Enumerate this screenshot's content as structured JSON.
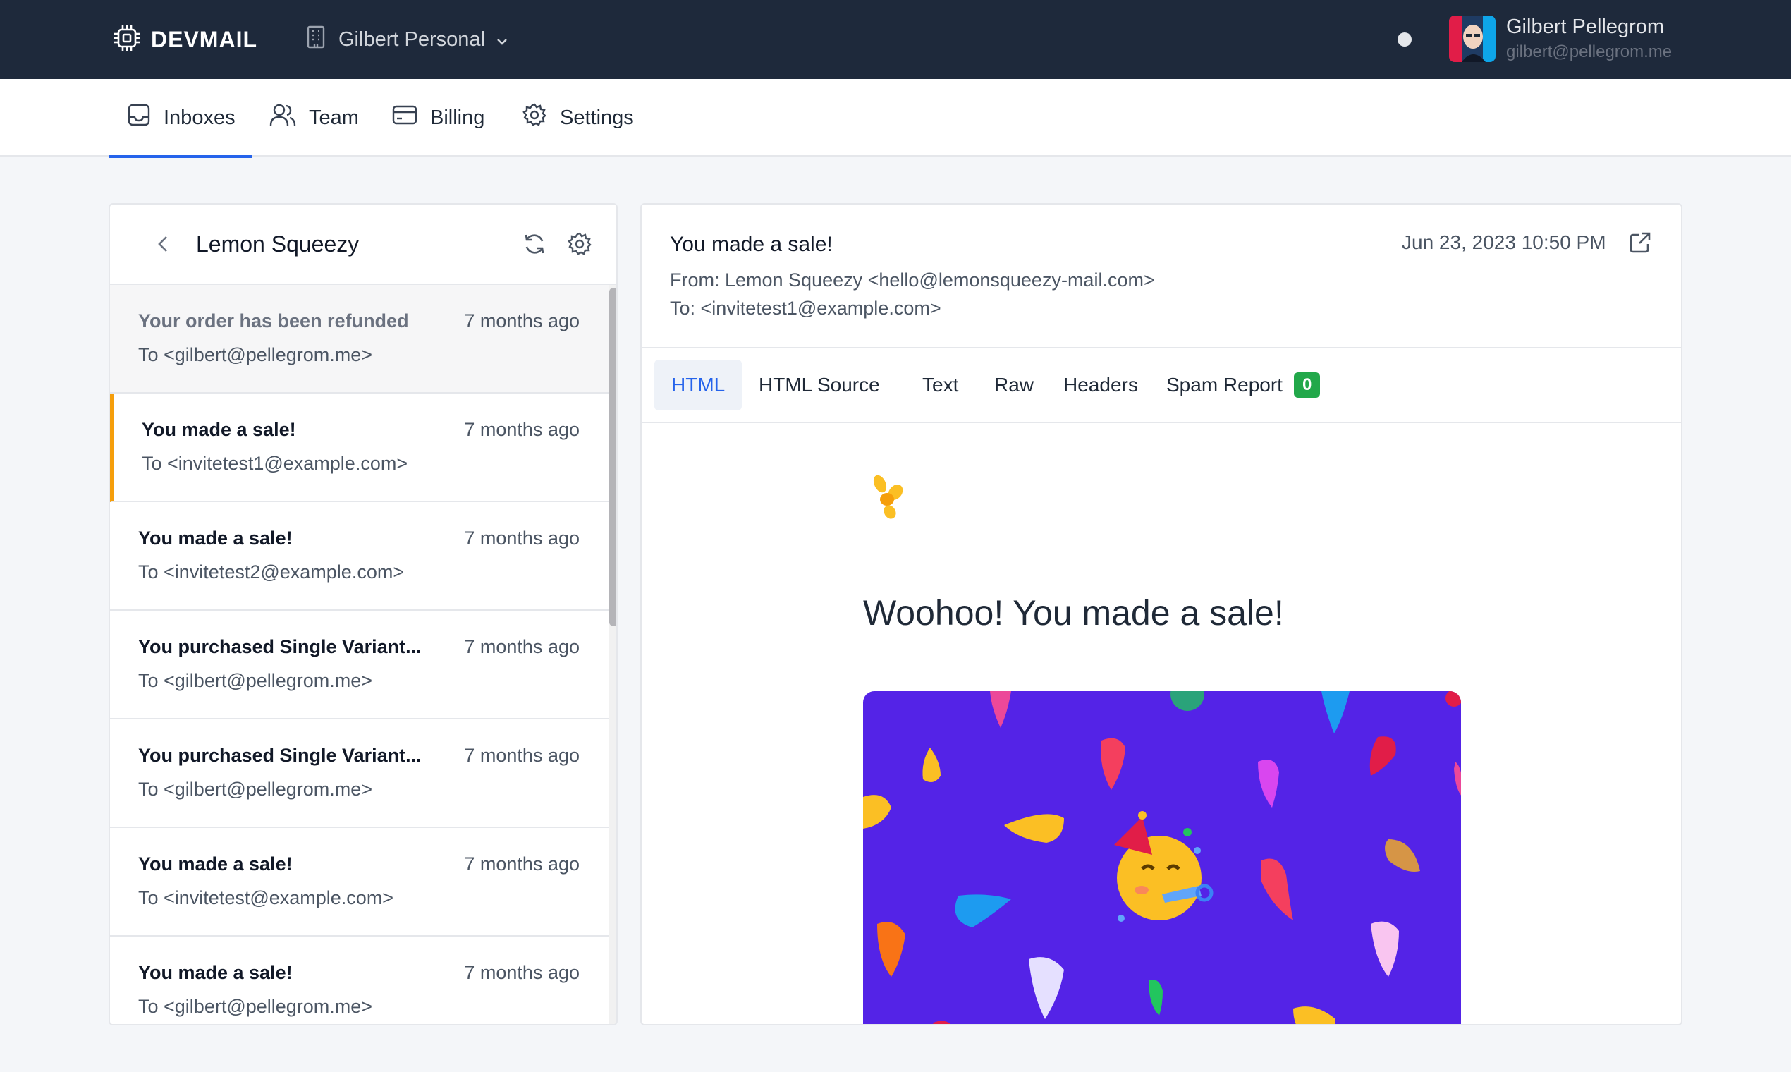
{
  "app": {
    "brand": "DEVMAIL"
  },
  "workspace": {
    "name": "Gilbert Personal"
  },
  "user": {
    "name": "Gilbert Pellegrom",
    "email": "gilbert@pellegrom.me"
  },
  "nav": [
    {
      "label": "Inboxes",
      "icon": "inbox-icon",
      "active": true
    },
    {
      "label": "Team",
      "icon": "users-icon",
      "active": false
    },
    {
      "label": "Billing",
      "icon": "credit-card-icon",
      "active": false
    },
    {
      "label": "Settings",
      "icon": "gear-icon",
      "active": false
    }
  ],
  "inbox": {
    "title": "Lemon Squeezy",
    "messages": [
      {
        "subject": "Your order has been refunded",
        "time": "7 months ago",
        "to": "To <gilbert@pellegrom.me>"
      },
      {
        "subject": "You made a sale!",
        "time": "7 months ago",
        "to": "To <invitetest1@example.com>"
      },
      {
        "subject": "You made a sale!",
        "time": "7 months ago",
        "to": "To <invitetest2@example.com>"
      },
      {
        "subject": "You purchased Single Variant...",
        "time": "7 months ago",
        "to": "To <gilbert@pellegrom.me>"
      },
      {
        "subject": "You purchased Single Variant...",
        "time": "7 months ago",
        "to": "To <gilbert@pellegrom.me>"
      },
      {
        "subject": "You made a sale!",
        "time": "7 months ago",
        "to": "To <invitetest@example.com>"
      },
      {
        "subject": "You made a sale!",
        "time": "7 months ago",
        "to": "To <gilbert@pellegrom.me>"
      }
    ]
  },
  "message": {
    "subject": "You made a sale!",
    "date": "Jun 23, 2023 10:50 PM",
    "from": "From: Lemon Squeezy <hello@lemonsqueezy-mail.com>",
    "to": "To: <invitetest1@example.com>",
    "tabs": [
      {
        "label": "HTML",
        "active": true
      },
      {
        "label": "HTML Source",
        "active": false
      },
      {
        "label": "Text",
        "active": false
      },
      {
        "label": "Raw",
        "active": false
      },
      {
        "label": "Headers",
        "active": false
      },
      {
        "label": "Spam Report",
        "active": false,
        "badge": "0"
      }
    ],
    "body": {
      "headline": "Woohoo! You made a sale!",
      "banner_color": "#5423e7",
      "banner_emoji": "partying-face-icon"
    }
  },
  "colors": {
    "accent": "#2563eb",
    "selected_marker": "#f59e0b",
    "badge": "#22a84a",
    "topbar": "#1e293b"
  }
}
